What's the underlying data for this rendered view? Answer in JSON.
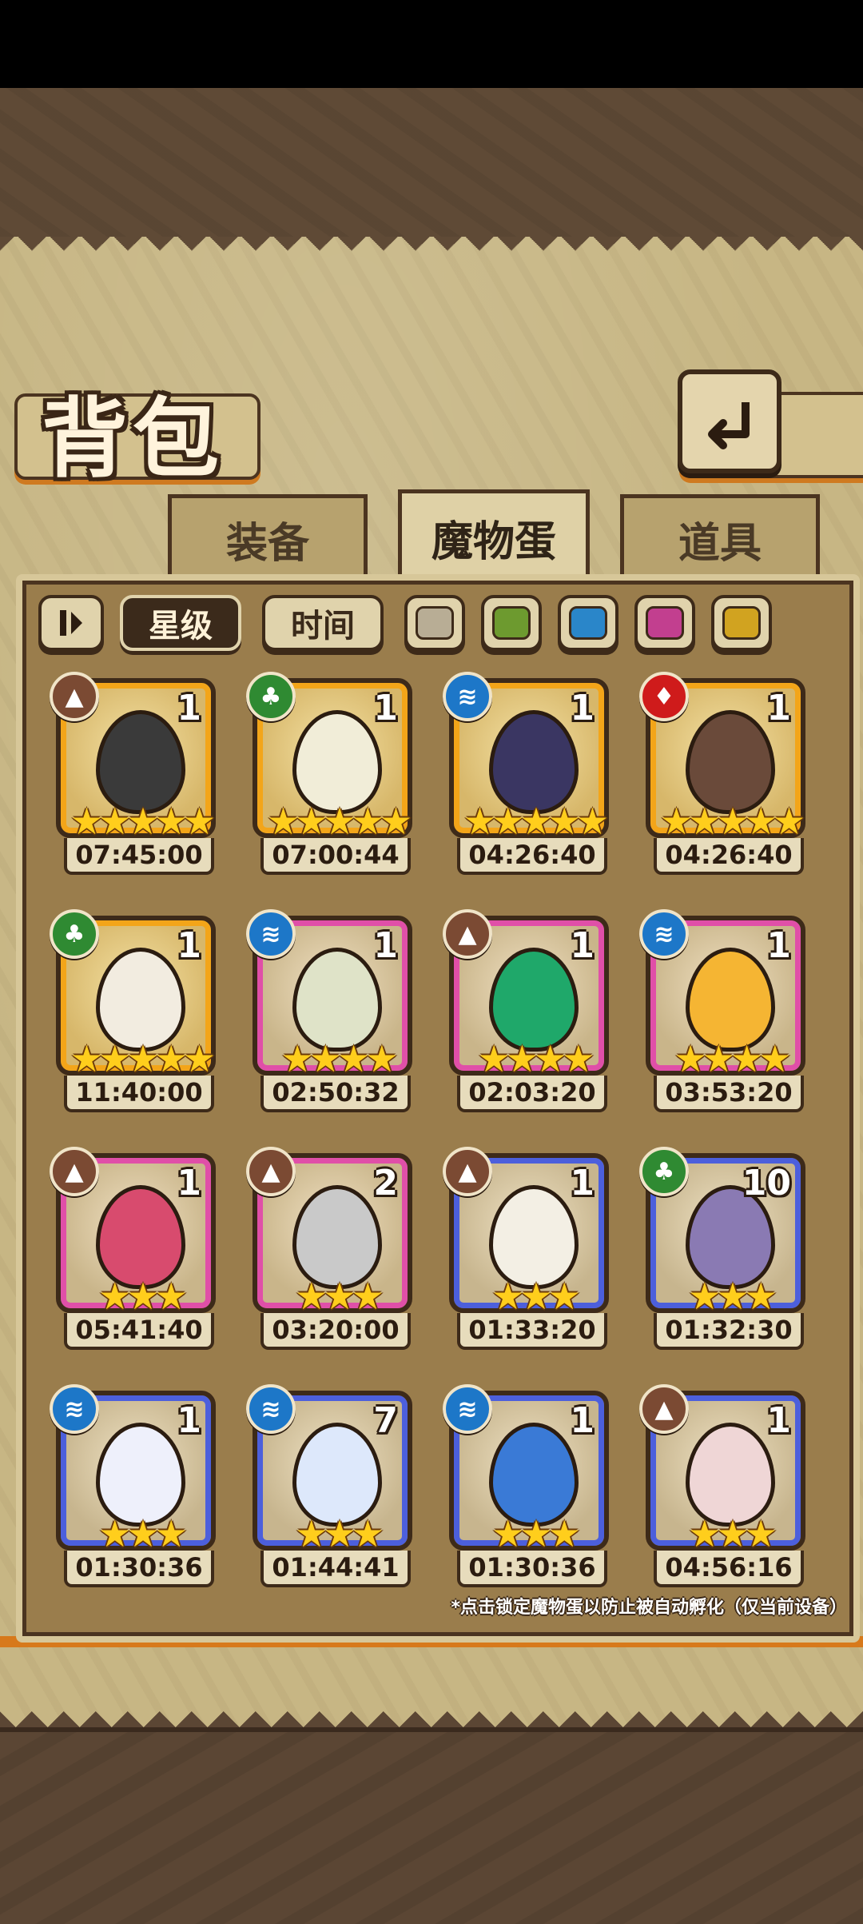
{
  "header": {
    "title": "背包"
  },
  "tabs": [
    {
      "label": "装备",
      "active": false
    },
    {
      "label": "魔物蛋",
      "active": true
    },
    {
      "label": "道具",
      "active": false
    }
  ],
  "sort": {
    "by_star": "星级",
    "by_time": "时间",
    "active": "星级"
  },
  "filters": {
    "colors": [
      "#b8ad95",
      "#6d9a2f",
      "#2a86c9",
      "#c23f8f",
      "#d1a320"
    ]
  },
  "eggs": [
    {
      "element": "earth",
      "element_icon": "▲",
      "count": "1",
      "stars": "★★★★★",
      "star_count": 5,
      "rarity_color": "gold",
      "timer": "07:45:00",
      "fill": "#3a3a3a"
    },
    {
      "element": "grass",
      "element_icon": "♣",
      "count": "1",
      "stars": "★★★★★",
      "star_count": 5,
      "rarity_color": "gold",
      "timer": "07:00:44",
      "fill": "#f1edd8"
    },
    {
      "element": "water",
      "element_icon": "≋",
      "count": "1",
      "stars": "★★★★★",
      "star_count": 5,
      "rarity_color": "gold",
      "timer": "04:26:40",
      "fill": "#3a3662"
    },
    {
      "element": "fire",
      "element_icon": "♦",
      "count": "1",
      "stars": "★★★★★",
      "star_count": 5,
      "rarity_color": "gold",
      "timer": "04:26:40",
      "fill": "#6a4a3a"
    },
    {
      "element": "grass",
      "element_icon": "♣",
      "count": "1",
      "stars": "★★★★★",
      "star_count": 5,
      "rarity_color": "gold",
      "timer": "11:40:00",
      "fill": "#f2ece0"
    },
    {
      "element": "water",
      "element_icon": "≋",
      "count": "1",
      "stars": "★★★★",
      "star_count": 4,
      "rarity_color": "pink",
      "timer": "02:50:32",
      "fill": "#dfe3c8"
    },
    {
      "element": "earth",
      "element_icon": "▲",
      "count": "1",
      "stars": "★★★★",
      "star_count": 4,
      "rarity_color": "pink",
      "timer": "02:03:20",
      "fill": "#1fa86a"
    },
    {
      "element": "water",
      "element_icon": "≋",
      "count": "1",
      "stars": "★★★★",
      "star_count": 4,
      "rarity_color": "pink",
      "timer": "03:53:20",
      "fill": "#f5b533"
    },
    {
      "element": "earth",
      "element_icon": "▲",
      "count": "1",
      "stars": "★★★",
      "star_count": 3,
      "rarity_color": "pink",
      "timer": "05:41:40",
      "fill": "#d84b6e"
    },
    {
      "element": "earth",
      "element_icon": "▲",
      "count": "2",
      "stars": "★★★",
      "star_count": 3,
      "rarity_color": "pink",
      "timer": "03:20:00",
      "fill": "#c9c9c9"
    },
    {
      "element": "earth",
      "element_icon": "▲",
      "count": "1",
      "stars": "★★★",
      "star_count": 3,
      "rarity_color": "blue",
      "timer": "01:33:20",
      "fill": "#f3efe4"
    },
    {
      "element": "grass",
      "element_icon": "♣",
      "count": "10",
      "stars": "★★★",
      "star_count": 3,
      "rarity_color": "blue",
      "timer": "01:32:30",
      "fill": "#8a7ab3"
    },
    {
      "element": "water",
      "element_icon": "≋",
      "count": "1",
      "stars": "★★★",
      "star_count": 3,
      "rarity_color": "blue",
      "timer": "01:30:36",
      "fill": "#eef0fb"
    },
    {
      "element": "water",
      "element_icon": "≋",
      "count": "7",
      "stars": "★★★",
      "star_count": 3,
      "rarity_color": "blue",
      "timer": "01:44:41",
      "fill": "#dde8fb"
    },
    {
      "element": "water",
      "element_icon": "≋",
      "count": "1",
      "stars": "★★★",
      "star_count": 3,
      "rarity_color": "blue",
      "timer": "01:30:36",
      "fill": "#3a7ad6"
    },
    {
      "element": "earth",
      "element_icon": "▲",
      "count": "1",
      "stars": "★★★",
      "star_count": 3,
      "rarity_color": "blue",
      "timer": "04:56:16",
      "fill": "#efd6d6"
    }
  ],
  "footnote": "*点击锁定魔物蛋以防止被自动孵化（仅当前设备）"
}
